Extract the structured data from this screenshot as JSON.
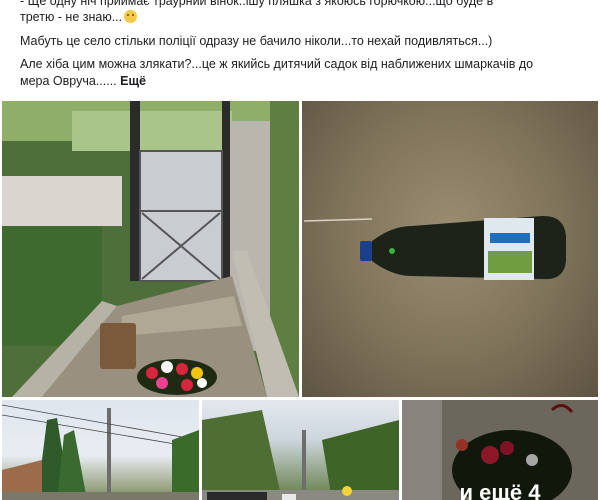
{
  "post": {
    "lines": [
      "- Ще одну ніч приймає траурний вінок..ішу пляшка з якоюсь горючкою...що буде в",
      "третю - не знаю...",
      "Мабуть це село стільки поліції одразу не бачило ніколи...то нехай подивляться...)",
      "Але хіба цим можна злякати?...це ж якийсь дитячий садок від наближених шмаркачів до",
      "мера Овруча......"
    ],
    "more_label": "Ещё"
  },
  "photos": [
    {
      "name": "yard-gate-photo",
      "description": ""
    },
    {
      "name": "bottle-photo",
      "description": ""
    },
    {
      "name": "street-photo",
      "description": ""
    },
    {
      "name": "police-car-photo",
      "description": ""
    },
    {
      "name": "wreath-photo",
      "overlay": "и ещё 4"
    }
  ],
  "colors": {
    "background": "#ffffff",
    "text": "#1c1e21",
    "overlay_text": "#ffffff"
  }
}
